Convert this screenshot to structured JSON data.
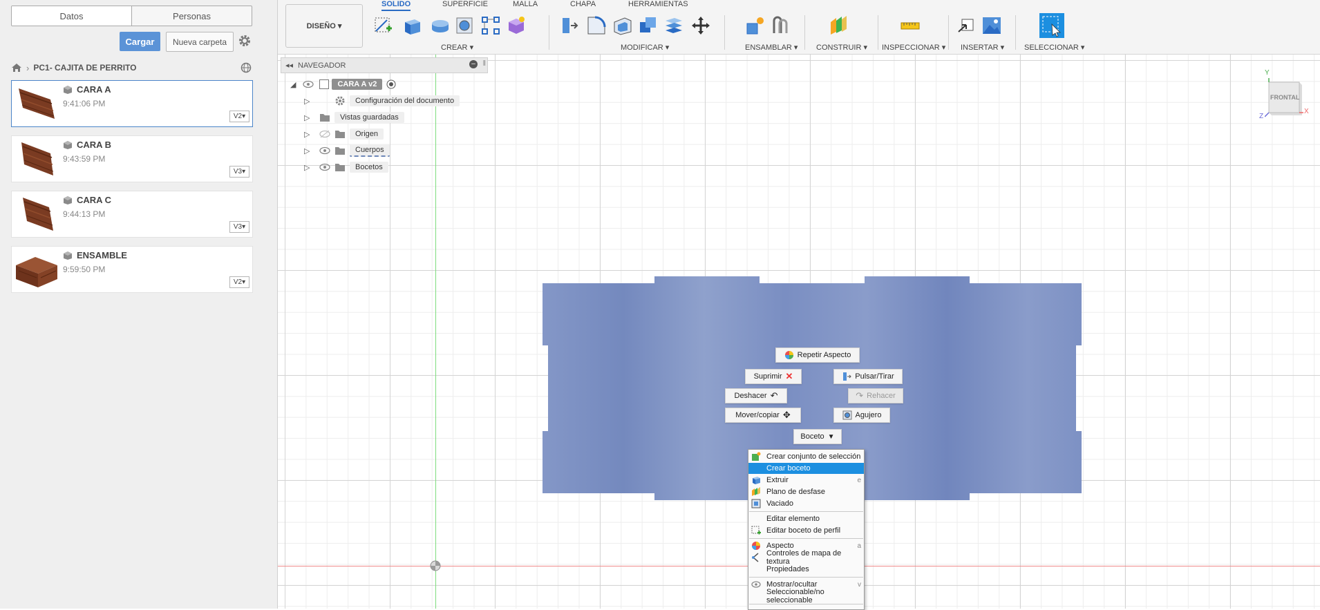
{
  "data_panel": {
    "tabs": [
      "Datos",
      "Personas"
    ],
    "upload_label": "Cargar",
    "new_folder_label": "Nueva carpeta",
    "project_name": "PC1- CAJITA DE PERRITO",
    "files": [
      {
        "name": "CARA A",
        "time": "9:41:06 PM",
        "version": "V2"
      },
      {
        "name": "CARA B",
        "time": "9:43:59 PM",
        "version": "V3"
      },
      {
        "name": "CARA C",
        "time": "9:44:13 PM",
        "version": "V3"
      },
      {
        "name": "ENSAMBLE",
        "time": "9:59:50 PM",
        "version": "V2"
      }
    ]
  },
  "toolbar": {
    "workspace": "DISEÑO",
    "tabs": [
      "SOLIDO",
      "SUPERFICIE",
      "MALLA",
      "CHAPA",
      "HERRAMIENTAS"
    ],
    "groups": [
      "CREAR",
      "MODIFICAR",
      "ENSAMBLAR",
      "CONSTRUIR",
      "INSPECCIONAR",
      "INSERTAR",
      "SELECCIONAR"
    ]
  },
  "browser": {
    "title": "NAVEGADOR",
    "root": "CARA A v2",
    "items": [
      "Configuración del documento",
      "Vistas guardadas",
      "Origen",
      "Cuerpos",
      "Bocetos"
    ]
  },
  "viewcube": {
    "face": "FRONTAL",
    "axis_y": "Y",
    "axis_x": "X",
    "axis_z": "Z"
  },
  "marking_menu": {
    "repeat": "Repetir Aspecto",
    "suppress": "Suprimir",
    "press_pull": "Pulsar/Tirar",
    "undo": "Deshacer",
    "redo": "Rehacer",
    "move_copy": "Mover/copiar",
    "hole": "Agujero",
    "sketch": "Boceto"
  },
  "context_menu": {
    "items": [
      {
        "label": "Crear conjunto de selección",
        "shortcut": ""
      },
      {
        "label": "Crear boceto",
        "shortcut": ""
      },
      {
        "label": "Extruir",
        "shortcut": "e"
      },
      {
        "label": "Plano de desfase",
        "shortcut": ""
      },
      {
        "label": "Vaciado",
        "shortcut": ""
      },
      {
        "label": "Editar elemento",
        "shortcut": ""
      },
      {
        "label": "Editar boceto de perfil",
        "shortcut": ""
      },
      {
        "label": "Aspecto",
        "shortcut": "a"
      },
      {
        "label": "Controles de mapa de textura",
        "shortcut": ""
      },
      {
        "label": "Propiedades",
        "shortcut": ""
      },
      {
        "label": "Mostrar/ocultar",
        "shortcut": "v"
      },
      {
        "label": "Seleccionable/no seleccionable",
        "shortcut": ""
      }
    ]
  },
  "colors": {
    "accent": "#2a6bc4",
    "face": "#7f94c6",
    "highlight": "#1c8fe0",
    "wood": "#7a3b22"
  }
}
